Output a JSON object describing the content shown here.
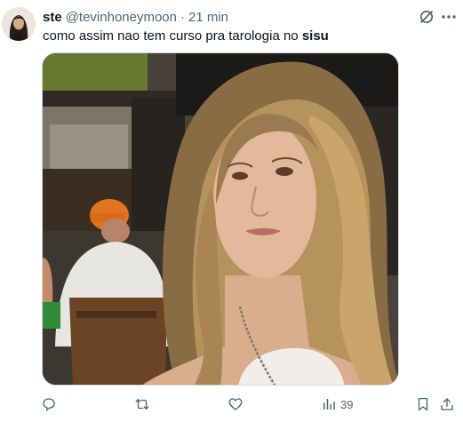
{
  "author": {
    "name": "ste",
    "handle": "@tevinhoneymoon",
    "separator": "·",
    "time": "21 min"
  },
  "post": {
    "text_before": "como assim nao tem curso pra tarologia no ",
    "text_bold": "sisu"
  },
  "media": {
    "description_icon": "photo-of-woman"
  },
  "actions": {
    "reply_icon": "reply-icon",
    "retweet_icon": "retweet-icon",
    "like_icon": "heart-icon",
    "views_icon": "views-icon",
    "views_count": "39",
    "bookmark_icon": "bookmark-icon",
    "share_icon": "share-icon"
  },
  "colors": {
    "text": "#0f1419",
    "secondary": "#536471",
    "border": "#cfd9de"
  }
}
